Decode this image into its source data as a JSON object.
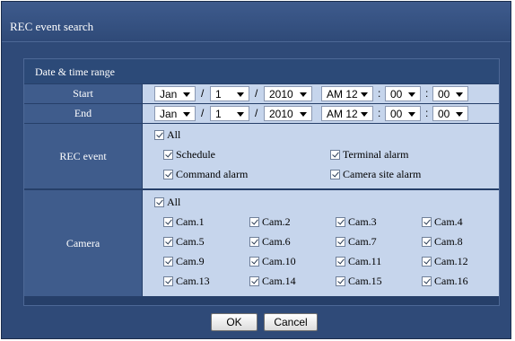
{
  "window": {
    "title": "REC event search"
  },
  "range": {
    "header": "Date & time range",
    "start": {
      "label": "Start",
      "month": "Jan",
      "day": "1",
      "year": "2010",
      "hour": "AM 12",
      "minute": "00",
      "second": "00"
    },
    "end": {
      "label": "End",
      "month": "Jan",
      "day": "1",
      "year": "2010",
      "hour": "AM 12",
      "minute": "00",
      "second": "00"
    },
    "slash": "/",
    "colon": ":"
  },
  "rec_event": {
    "label": "REC event",
    "all": "All",
    "items": [
      "Schedule",
      "Terminal alarm",
      "Command alarm",
      "Camera site alarm"
    ]
  },
  "camera": {
    "label": "Camera",
    "all": "All",
    "items": [
      "Cam.1",
      "Cam.2",
      "Cam.3",
      "Cam.4",
      "Cam.5",
      "Cam.6",
      "Cam.7",
      "Cam.8",
      "Cam.9",
      "Cam.10",
      "Cam.11",
      "Cam.12",
      "Cam.13",
      "Cam.14",
      "Cam.15",
      "Cam.16"
    ]
  },
  "buttons": {
    "ok": "OK",
    "cancel": "Cancel"
  },
  "icons": {
    "dropdown": "chevron-down-icon",
    "checkbox": "checkbox-checked-icon"
  }
}
